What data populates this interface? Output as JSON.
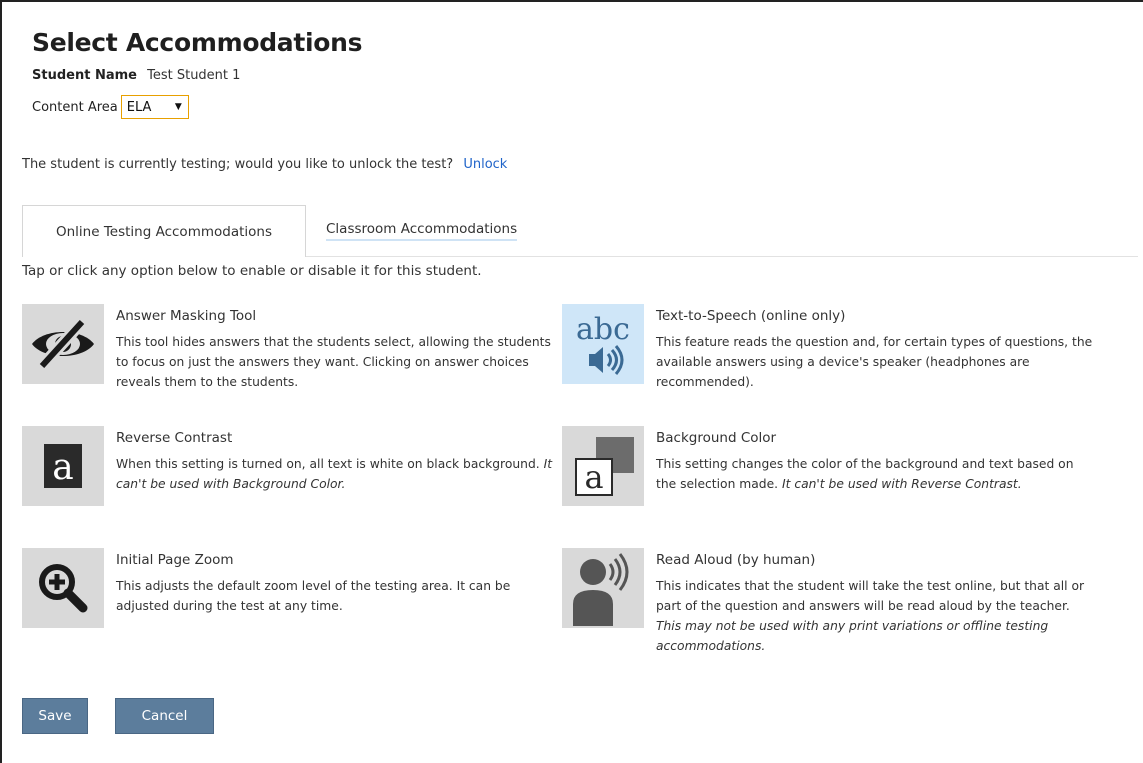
{
  "header": {
    "title": "Select Accommodations",
    "student_label": "Student Name",
    "student_value": "Test Student 1",
    "content_label": "Content Area",
    "content_value": "ELA"
  },
  "testing_notice": {
    "text": "The student is currently testing; would you like to unlock the test?",
    "link": "Unlock"
  },
  "tabs": [
    {
      "label": "Online Testing Accommodations",
      "active": true
    },
    {
      "label": "Classroom Accommodations",
      "active": false
    }
  ],
  "instructions": "Tap or click any option below to enable or disable it for this student.",
  "accommodations": [
    {
      "name": "Answer Masking Tool",
      "desc": "This tool hides answers that the students select, allowing the students to focus on just the answers they want. Clicking on answer choices reveals them to the students.",
      "note": "",
      "icon": "eye-slash-icon"
    },
    {
      "name": "Text-to-Speech (online only)",
      "desc": "This feature reads the question and, for certain types of questions, the available answers using a device's speaker (headphones are recommended).",
      "note": "",
      "icon": "text-to-speech-icon",
      "icon_text": "abc"
    },
    {
      "name": "Reverse Contrast",
      "desc": "When this setting is turned on, all text is white on black background. ",
      "note": "It can't be used with Background Color.",
      "icon": "reverse-contrast-icon",
      "icon_text": "a"
    },
    {
      "name": "Background Color",
      "desc": "This setting changes the color of the background and text based on the selection made. ",
      "note": "It can't be used with Reverse Contrast.",
      "icon": "background-color-icon",
      "icon_text": "a"
    },
    {
      "name": "Initial Page Zoom",
      "desc": "This adjusts the default zoom level of the testing area. It can be adjusted during the test at any time.",
      "note": "",
      "icon": "zoom-in-icon"
    },
    {
      "name": "Read Aloud (by human)",
      "desc": "This indicates that the student will take the test online, but that all or part of the question and answers will be read aloud by the teacher. ",
      "note": "This may not be used with any print variations or offline testing accommodations.",
      "icon": "read-aloud-icon"
    }
  ],
  "buttons": {
    "save": "Save",
    "cancel": "Cancel"
  },
  "colors": {
    "link": "#1f63c9",
    "button": "#5c7d9c",
    "select_border": "#e8a000",
    "icon_bg": "#d9d9d9",
    "icon_bg_blue": "#cfe6f8"
  }
}
